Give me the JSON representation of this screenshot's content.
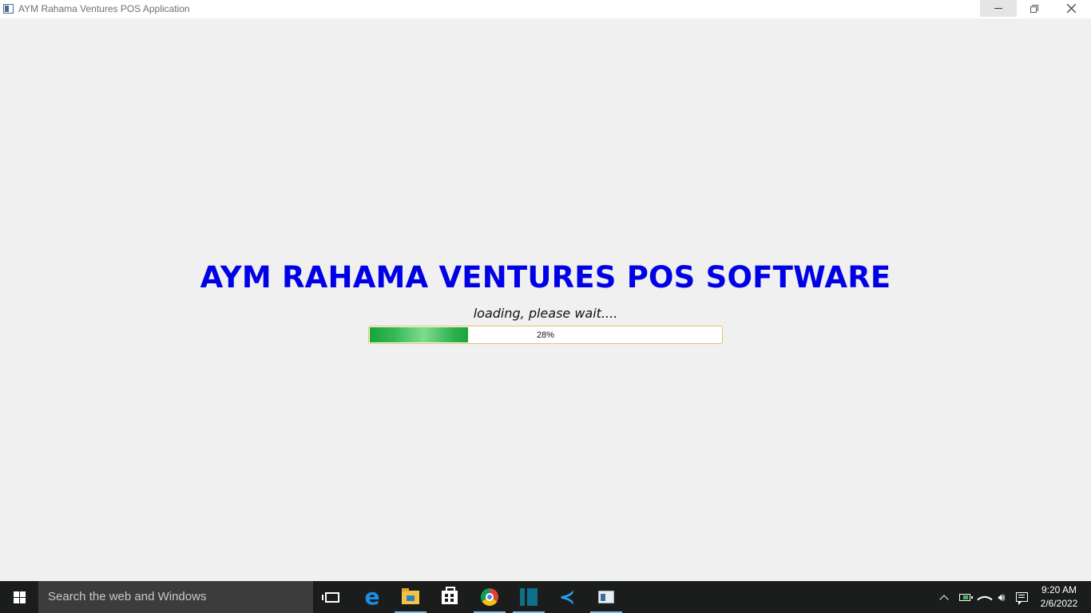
{
  "window": {
    "title": "AYM Rahama Ventures POS Application",
    "controls": [
      "minimize",
      "restore",
      "close"
    ]
  },
  "splash": {
    "heading": "AYM RAHAMA VENTURES POS SOFTWARE",
    "loading_text": "loading, please wait....",
    "progress_percent": 28,
    "progress_label": "28%",
    "heading_color": "#0000e6",
    "progress_color": "#13a638"
  },
  "taskbar": {
    "search_placeholder": "Search the web and Windows",
    "apps": [
      {
        "name": "task-view-icon"
      },
      {
        "name": "edge-icon"
      },
      {
        "name": "file-explorer-icon",
        "active": true
      },
      {
        "name": "store-icon"
      },
      {
        "name": "chrome-icon",
        "active": true
      },
      {
        "name": "app-icon",
        "active": true
      },
      {
        "name": "vscode-icon"
      },
      {
        "name": "pos-app-icon",
        "active": true
      }
    ],
    "clock": {
      "time": "9:20 AM",
      "date": "2/6/2022"
    }
  }
}
